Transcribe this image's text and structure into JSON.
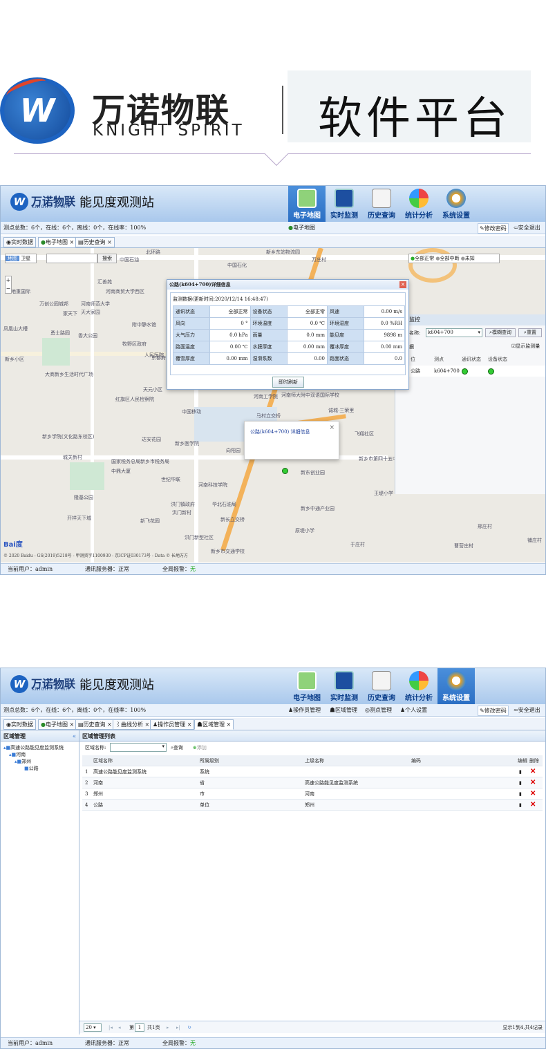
{
  "banner": {
    "brand_cn": "万诺物联",
    "brand_en": "KNIGHT SPIRIT",
    "platform": "软件平台"
  },
  "app": {
    "brand_cn": "万诺物联",
    "brand_en": "KNIGHT SPIRIT",
    "title": "能见度观测站",
    "nav": [
      "电子地图",
      "实时监测",
      "历史查询",
      "统计分析",
      "系统设置"
    ],
    "stats": "测点总数：6个，在线：6个，离线：0个，在线率：100%",
    "pwd": "修改密码",
    "logout": "安全退出",
    "status": {
      "user": "当前用户：admin",
      "server": "通讯服务器：正常",
      "alarm_label": "全局报警：",
      "alarm_value": "无"
    }
  },
  "screen1": {
    "crumb": "电子地图",
    "tabs": [
      "实时数据",
      "电子地图",
      "历史查询"
    ],
    "map": {
      "maptypes": [
        "地图",
        "卫星"
      ],
      "search_btn": "搜索",
      "legend": [
        "全部正常",
        "全部中断",
        "未知"
      ],
      "copyright": "© 2020 Baidu - GS(2019)5218号 - 甲测资字1100930 - 京ICP证030173号 - Data © 长地万方",
      "labels": [
        "北环路",
        "中国石油",
        "新乡东站物流园",
        "万庄村",
        "中国石化",
        "汇善苑",
        "河南商贸大学西区",
        "卫北",
        "北地重国际",
        "万创公园城邦",
        "河南师范大学",
        "家天下",
        "天大家园",
        "附中静水馆",
        "凤凰山大槽",
        "勇士路园",
        "香大公园",
        "牧野区政府",
        "东都府",
        "新乡小区",
        "人民医院",
        "大商新乡生活时代广场",
        "天元小区",
        "红旗区人民检察院",
        "中国移动",
        "河南工学院",
        "河南师大附中双语国际学校",
        "诚城·三荣里",
        "马村立交桥",
        "飞翔社区",
        "新乡学院(文化路东校区)",
        "新乡医学院",
        "达安花园",
        "向阳园",
        "新乡市第四十五中学",
        "城关新村",
        "国家税务总局新乡市税务局",
        "新东创业园",
        "河南科技学院",
        "王堤小学",
        "隆基公园",
        "中鼎大厦",
        "世纪华联",
        "洪门镇政府",
        "华北石油局",
        "新乡中通产业园",
        "开祥天下城",
        "新长立交桥",
        "洪门新村",
        "原堤小学",
        "新飞花园",
        "洪门新型社区",
        "新乡市交通学校",
        "于庄村",
        "曹营庄村",
        "邢庄村",
        "铺庄村"
      ]
    },
    "popup": {
      "title": "公路(k604+700)详细信息",
      "updated": "监测数据(更新时间:2020/12/14 16:48:47)",
      "rows": [
        [
          "通讯状态",
          "全部正常",
          "设备状态",
          "全部正常",
          "风速",
          "0.00 m/s"
        ],
        [
          "风向",
          "0 °",
          "环境温度",
          "0.0 ℃",
          "环境湿度",
          "0.0 %RH"
        ],
        [
          "大气压力",
          "0.0 hPa",
          "雨量",
          "0.0 mm",
          "能见度",
          "9898 m"
        ],
        [
          "路面温度",
          "0.00 ℃",
          "水膜厚度",
          "0.00 mm",
          "覆冰厚度",
          "0.00 mm"
        ],
        [
          "覆雪厚度",
          "0.00 mm",
          "湿滑系数",
          "0.00",
          "路面状态",
          "0.0"
        ]
      ],
      "refresh": "即时刷新"
    },
    "tooltip": "公路(k604+700) 详细信息",
    "monitor": {
      "title": "监控",
      "name_label": "名称:",
      "selected": "k604+700",
      "search_btn": "模糊查询",
      "reset_btn": "重置",
      "sub": "据",
      "show_label": "显示监测量",
      "cols": [
        "位",
        "测点",
        "通讯状态",
        "设备状态"
      ],
      "row": [
        "公路",
        "k604+700"
      ]
    }
  },
  "screen2": {
    "nav2": [
      "操作员管理",
      "区域管理",
      "测点管理",
      "个人设置"
    ],
    "tabs": [
      "实时数据",
      "电子地图",
      "历史查询",
      "曲线分析",
      "操作员管理",
      "区域管理"
    ],
    "left": {
      "title": "区域管理",
      "tree": [
        "高速公路能见度监测系统",
        "河南",
        "郑州",
        "公路"
      ]
    },
    "list": {
      "title": "区域管理列表",
      "filter_label": "区域名称:",
      "query": "查询",
      "add": "添加",
      "cols": [
        "区域名称",
        "所属级别",
        "上级名称",
        "编码",
        "编辑",
        "删除"
      ],
      "rows": [
        [
          "1",
          "高速公路能见度监测系统",
          "系统",
          ""
        ],
        [
          "2",
          "河南",
          "省",
          "高速公路能见度监测系统"
        ],
        [
          "3",
          "郑州",
          "市",
          "河南"
        ],
        [
          "4",
          "公路",
          "单位",
          "郑州"
        ]
      ],
      "pager": {
        "size": "20",
        "page_label": "第",
        "page": "1",
        "total": "共1页",
        "summary": "显示1到4,共4记录"
      }
    }
  }
}
